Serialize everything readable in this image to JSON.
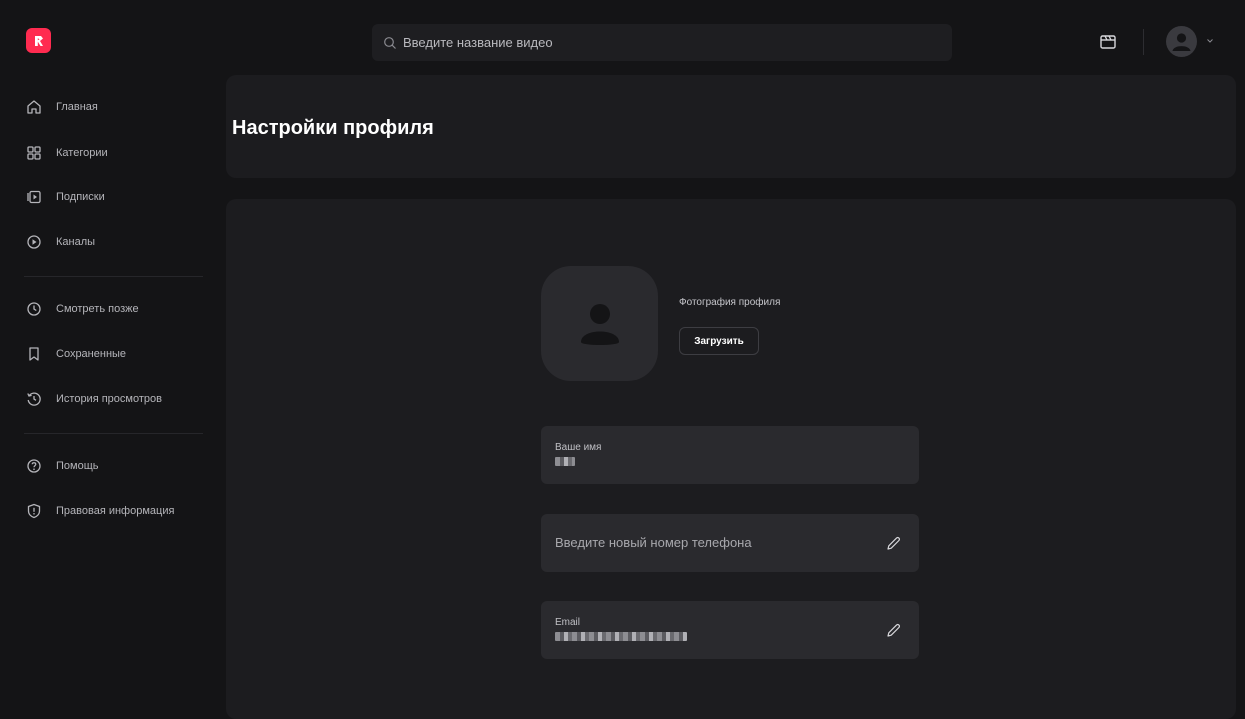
{
  "header": {
    "search_placeholder": "Введите название видео"
  },
  "sidebar": {
    "items": [
      {
        "label": "Главная",
        "icon": "home-icon"
      },
      {
        "label": "Категории",
        "icon": "grid-icon"
      },
      {
        "label": "Подписки",
        "icon": "subscriptions-icon"
      },
      {
        "label": "Каналы",
        "icon": "play-circle-icon"
      },
      {
        "label": "Смотреть позже",
        "icon": "clock-icon"
      },
      {
        "label": "Сохраненные",
        "icon": "bookmark-icon"
      },
      {
        "label": "История просмотров",
        "icon": "history-icon"
      },
      {
        "label": "Помощь",
        "icon": "help-icon"
      },
      {
        "label": "Правовая информация",
        "icon": "shield-icon"
      }
    ]
  },
  "page": {
    "title": "Настройки профиля"
  },
  "profile": {
    "photo_label": "Фотография профиля",
    "upload_label": "Загрузить",
    "name_label": "Ваше имя",
    "phone_placeholder": "Введите новый номер телефона",
    "email_label": "Email"
  },
  "colors": {
    "accent": "#ff2b50",
    "background": "#141416",
    "panel": "#1c1c1f",
    "field": "#2a2a2e"
  }
}
